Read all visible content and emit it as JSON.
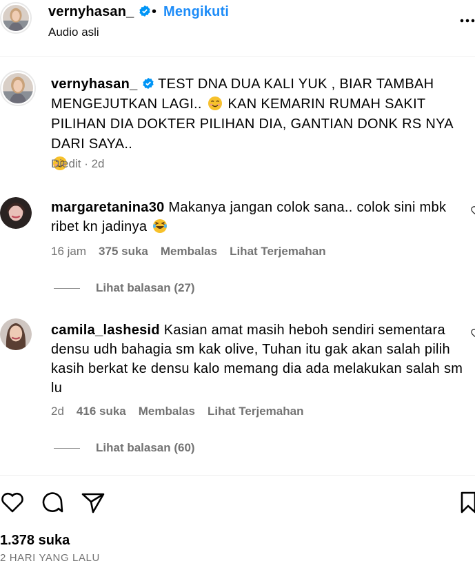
{
  "header": {
    "username": "vernyhasan_",
    "separator": "•",
    "follow_label": "Mengikuti",
    "subtitle": "Audio asli",
    "avatar_icon": "profile-avatar-icon",
    "more_icon": "more-options-icon"
  },
  "caption": {
    "username": "vernyhasan_",
    "text_part1": " TEST DNA DUA KALI YUK , BIAR TAMBAH MENGEJUTKAN LAGI..",
    "text_part2": " KAN KEMARIN RUMAH SAKIT PILIHAN DIA DOKTER PILIHAN DIA, GANTIAN DONK RS NYA DARI SAYA..",
    "edited_label": "Diedit",
    "time": "· 2d",
    "emoji": "smiling-face-icon"
  },
  "comments": [
    {
      "username": "margaretanina30",
      "text": " Makanya jangan colok sana.. colok sini mbk ribet kn jadinya",
      "emoji": "laughing-tears-icon",
      "time": "16 jam",
      "likes": "375 suka",
      "reply_label": "Membalas",
      "translate_label": "Lihat Terjemahan",
      "view_replies": "Lihat balasan (27)"
    },
    {
      "username": "camila_lashesid",
      "text": " Kasian amat masih heboh sendiri sementara densu udh bahagia sm kak olive, Tuhan itu gak akan salah pilih kasih berkat ke densu kalo memang dia ada melakukan salah sm lu",
      "time": "2d",
      "likes": "416 suka",
      "reply_label": "Membalas",
      "translate_label": "Lihat Terjemahan",
      "view_replies": "Lihat balasan (60)"
    }
  ],
  "actions": {
    "like_icon": "heart-icon",
    "comment_icon": "comment-icon",
    "share_icon": "share-icon",
    "save_icon": "bookmark-icon"
  },
  "footer": {
    "likes": "1.378 suka",
    "date": "2 HARI YANG LALU"
  },
  "colors": {
    "accent": "#1d8cf8",
    "muted": "#737373",
    "verified": "#0095f6"
  }
}
